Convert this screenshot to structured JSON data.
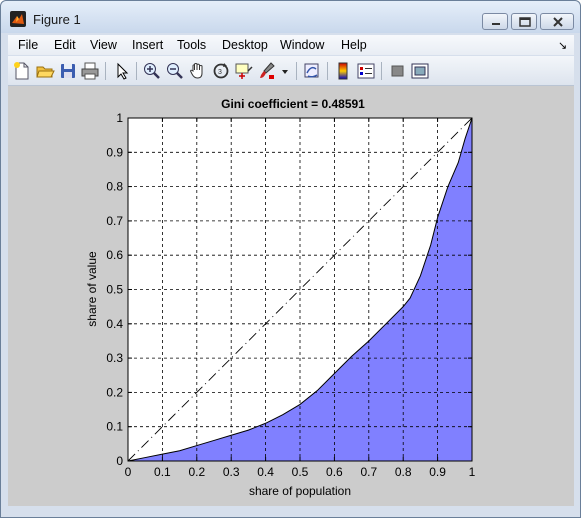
{
  "window": {
    "title": "Figure 1",
    "controls": [
      "minimize-icon",
      "maximize-icon",
      "close-icon"
    ]
  },
  "menu": {
    "items": [
      "File",
      "Edit",
      "View",
      "Insert",
      "Tools",
      "Desktop",
      "Window",
      "Help"
    ],
    "dock_arrow": "↘"
  },
  "toolbar": {
    "buttons": [
      "new-figure-icon",
      "open-file-icon",
      "save-icon",
      "print-icon",
      "edit-plot-arrow-icon",
      "zoom-in-icon",
      "zoom-out-icon",
      "pan-hand-icon",
      "rotate-3d-icon",
      "data-cursor-icon",
      "brush-icon",
      "link-plot-icon",
      "colorbar-icon",
      "legend-icon",
      "hide-plot-tools-icon",
      "show-plot-tools-icon"
    ]
  },
  "colors": {
    "area_fill": "#8080ff",
    "figure_bg": "#cccccc",
    "axes_bg": "#ffffff"
  },
  "chart_data": {
    "type": "area",
    "title": "Gini coefficient = 0.48591",
    "xlabel": "share of population",
    "ylabel": "share of value",
    "xlim": [
      0,
      1
    ],
    "ylim": [
      0,
      1
    ],
    "xticks": [
      "0",
      "0.1",
      "0.2",
      "0.3",
      "0.4",
      "0.5",
      "0.6",
      "0.7",
      "0.8",
      "0.9",
      "1"
    ],
    "yticks": [
      "0",
      "0.1",
      "0.2",
      "0.3",
      "0.4",
      "0.5",
      "0.6",
      "0.7",
      "0.8",
      "0.9",
      "1"
    ],
    "grid": true,
    "grid_style": "dashed",
    "series": [
      {
        "type": "area",
        "x": [
          0,
          0.05,
          0.1,
          0.15,
          0.2,
          0.25,
          0.3,
          0.35,
          0.4,
          0.45,
          0.5,
          0.55,
          0.6,
          0.65,
          0.7,
          0.75,
          0.8,
          0.82,
          0.85,
          0.88,
          0.9,
          0.93,
          0.96,
          0.98,
          1
        ],
        "y": [
          0,
          0.01,
          0.02,
          0.03,
          0.045,
          0.06,
          0.075,
          0.09,
          0.11,
          0.135,
          0.165,
          0.205,
          0.255,
          0.305,
          0.35,
          0.4,
          0.45,
          0.475,
          0.54,
          0.63,
          0.71,
          0.8,
          0.87,
          0.94,
          1
        ]
      },
      {
        "type": "line",
        "style": "dash-dot",
        "x": [
          0,
          1
        ],
        "y": [
          0,
          1
        ]
      }
    ]
  }
}
